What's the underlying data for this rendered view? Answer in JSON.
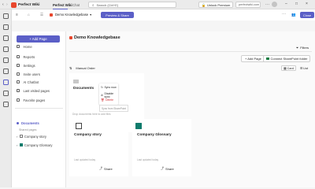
{
  "colors": {
    "accent": "#5b5fc7",
    "brand": "#e8462c",
    "connect_icon": "#107c41",
    "delete": "#d13438",
    "green_tile": "#0f7b6c"
  },
  "titlebar": {
    "app_name": "Perfect Wiki",
    "tabs": [
      {
        "label": "Perfect Wiki"
      },
      {
        "label": "Chat"
      }
    ],
    "search_placeholder": "Search (Ctrl+E)",
    "unlock_label": "Unlock Premium",
    "account_label": "perfectwiki.com",
    "present_label": "Present now"
  },
  "header": {
    "kb_name": "Demo Knowledgebase",
    "preview_label": "Preview & Share",
    "close_label": "Close"
  },
  "sidebar": {
    "add_page_label": "+ Add Page",
    "items": [
      {
        "label": "Home",
        "icon": "home-icon"
      },
      {
        "label": "Reports",
        "icon": "chart-icon"
      },
      {
        "label": "Settings",
        "icon": "gear-icon"
      },
      {
        "label": "Invite users",
        "icon": "add-user-icon"
      },
      {
        "label": "AI Chatbot",
        "icon": "bot-icon"
      },
      {
        "label": "Last visited pages",
        "icon": "clock-icon"
      },
      {
        "label": "Favorite pages",
        "icon": "star-icon"
      }
    ],
    "documents_label": "Documents",
    "section_label": "Shared pages",
    "tree": [
      {
        "label": "Company story"
      },
      {
        "label": "Company Glossary"
      }
    ]
  },
  "main": {
    "title": "Demo Knowledgebase",
    "filters_label": "Filters",
    "add_page_label": "+ Add Page",
    "connect_label": "Connect SharePoint folder",
    "manual_order_label": "Manual Order",
    "view_card_label": "Card",
    "view_list_label": "List",
    "cards": [
      {
        "title": "Documents",
        "meta": "Drop documents here to add files",
        "share": ""
      },
      {
        "title": "Company story",
        "meta": "Last updated today",
        "share": "Share"
      },
      {
        "title": "Company Glossary",
        "meta": "Last updated today",
        "share": "Share"
      }
    ],
    "context_menu": [
      "Sync now",
      "Disable sync",
      "Delete"
    ],
    "tooltip": "Sync from SharePoint"
  }
}
